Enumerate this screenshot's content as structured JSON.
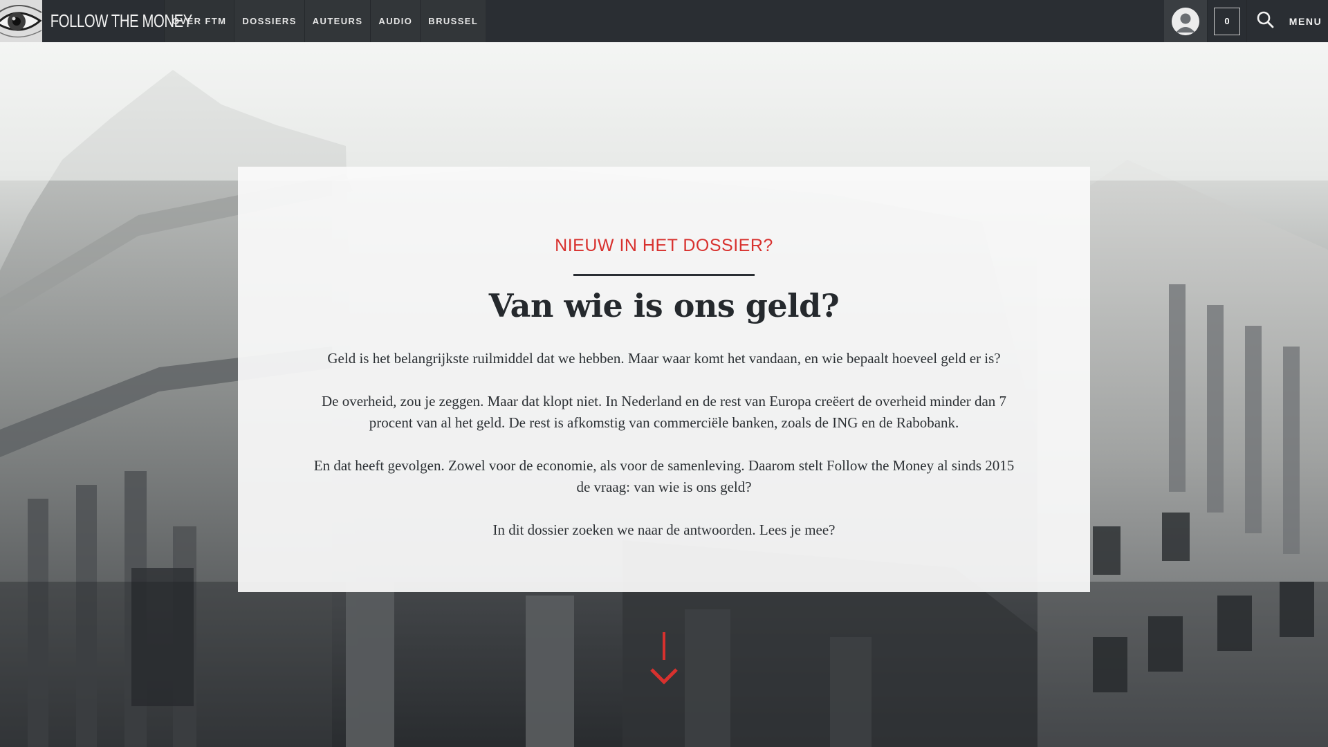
{
  "header": {
    "brand": "FOLLOW THE MONEY",
    "nav": [
      {
        "label": "OVER FTM"
      },
      {
        "label": "DOSSIERS"
      },
      {
        "label": "AUTEURS"
      },
      {
        "label": "AUDIO"
      },
      {
        "label": "BRUSSEL"
      }
    ],
    "cart_count": "0",
    "menu_label": "MENU",
    "icons": {
      "logo": "eye-icon",
      "account": "user-avatar-icon",
      "search": "search-icon"
    }
  },
  "intro": {
    "kicker": "NIEUW IN HET DOSSIER?",
    "title": "Van wie is ons geld?",
    "paragraphs": [
      "Geld is het belangrijkste ruilmiddel dat we hebben. Maar waar komt het vandaan, en wie bepaalt hoeveel geld er is?",
      "De overheid, zou je zeggen. Maar dat klopt niet. In Nederland en de rest van Europa creëert de overheid minder dan 7 procent van al het geld. De rest is afkomstig van commerciële banken, zoals de ING en de Rabobank.",
      "En dat heeft gevolgen. Zowel voor de economie, als voor de samenleving. Daarom stelt Follow the Money al sinds 2015 de vraag: van wie is ons geld?",
      "In dit dossier zoeken we naar de antwoorden. Lees je mee?"
    ]
  },
  "scroll": {
    "icon": "arrow-down-icon"
  },
  "colors": {
    "accent": "#d8312e",
    "topbar": "#2a2e33",
    "text": "#25292d"
  }
}
